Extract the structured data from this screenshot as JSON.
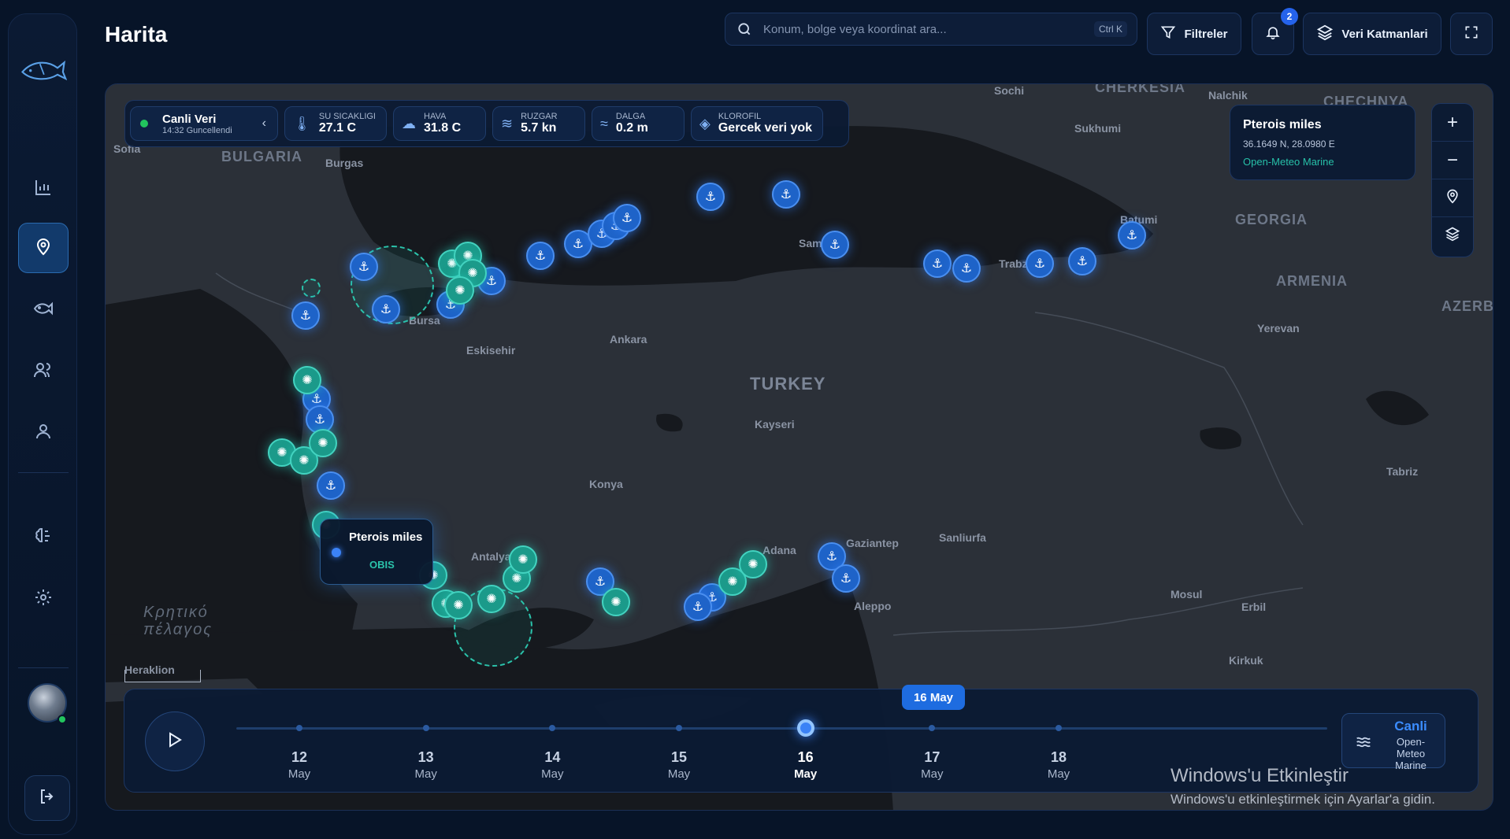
{
  "header": {
    "title": "Harita",
    "search_placeholder": "Konum, bolge veya koordinat ara...",
    "search_shortcut": "Ctrl K",
    "filters_label": "Filtreler",
    "notification_count": "2",
    "layers_label": "Veri Katmanlari"
  },
  "sidebar": {
    "items": [
      {
        "name": "analytics",
        "icon": "bar-chart-icon"
      },
      {
        "name": "map",
        "icon": "map-pin-icon",
        "active": true
      },
      {
        "name": "species",
        "icon": "fish-icon"
      },
      {
        "name": "community",
        "icon": "users-icon"
      },
      {
        "name": "profile",
        "icon": "user-icon"
      },
      {
        "name": "ai",
        "icon": "brain-icon"
      },
      {
        "name": "settings",
        "icon": "gear-icon"
      }
    ]
  },
  "live": {
    "title": "Canli Veri",
    "updated": "14:32 Guncellendi"
  },
  "stats": [
    {
      "label": "SU SICAKLIGI",
      "value": "27.1 C",
      "icon": "thermometer-icon"
    },
    {
      "label": "HAVA",
      "value": "31.8 C",
      "icon": "weather-icon"
    },
    {
      "label": "RUZGAR",
      "value": "5.7 kn",
      "icon": "wind-icon"
    },
    {
      "label": "DALGA",
      "value": "0.2 m",
      "icon": "wave-icon"
    },
    {
      "label": "KLOROFIL",
      "value": "Gercek veri yok",
      "icon": "layers-icon"
    }
  ],
  "info_card": {
    "name": "Pterois miles",
    "coords": "36.1649 N, 28.0980 E",
    "source": "Open-Meteo Marine"
  },
  "popup": {
    "name": "Pterois miles",
    "source": "OBIS"
  },
  "map_labels": {
    "countries": [
      "BULGARIA",
      "TURKEY",
      "GEORGIA",
      "ARMENIA",
      "AZERB"
    ],
    "cities": [
      "Burgas",
      "Sochi",
      "Sukhumi",
      "Batumi",
      "Samsun",
      "Trabzon",
      "Ankara",
      "Eskisehir",
      "Bursa",
      "Kayseri",
      "Konya",
      "Gaziantep",
      "Sanliurfa",
      "Aleppo",
      "Mosul",
      "Erbil",
      "Kirkuk",
      "Tabriz",
      "Yerevan",
      "Adana",
      "Antalya",
      "Heraklion",
      "Nalchik",
      "CHECHNYA",
      "CHERKESIA",
      "Sofia"
    ],
    "sea": "Κρητικό πέλαγος"
  },
  "timeline": {
    "days": [
      {
        "day": "12",
        "month": "May"
      },
      {
        "day": "13",
        "month": "May"
      },
      {
        "day": "14",
        "month": "May"
      },
      {
        "day": "15",
        "month": "May"
      },
      {
        "day": "16",
        "month": "May",
        "active": true
      },
      {
        "day": "17",
        "month": "May"
      },
      {
        "day": "18",
        "month": "May"
      }
    ],
    "selected": "16 May",
    "live_title": "Canli",
    "live_source": "Open-Meteo Marine"
  },
  "watermark": {
    "line1": "Windows'u Etkinleştir",
    "line2": "Windows'u etkinleştirmek için Ayarlar'a gidin."
  },
  "colors": {
    "accent": "#1e6ce0",
    "port_marker": "#1e63c8",
    "species_marker": "#1b9a8a",
    "live_green": "#22c55e"
  }
}
